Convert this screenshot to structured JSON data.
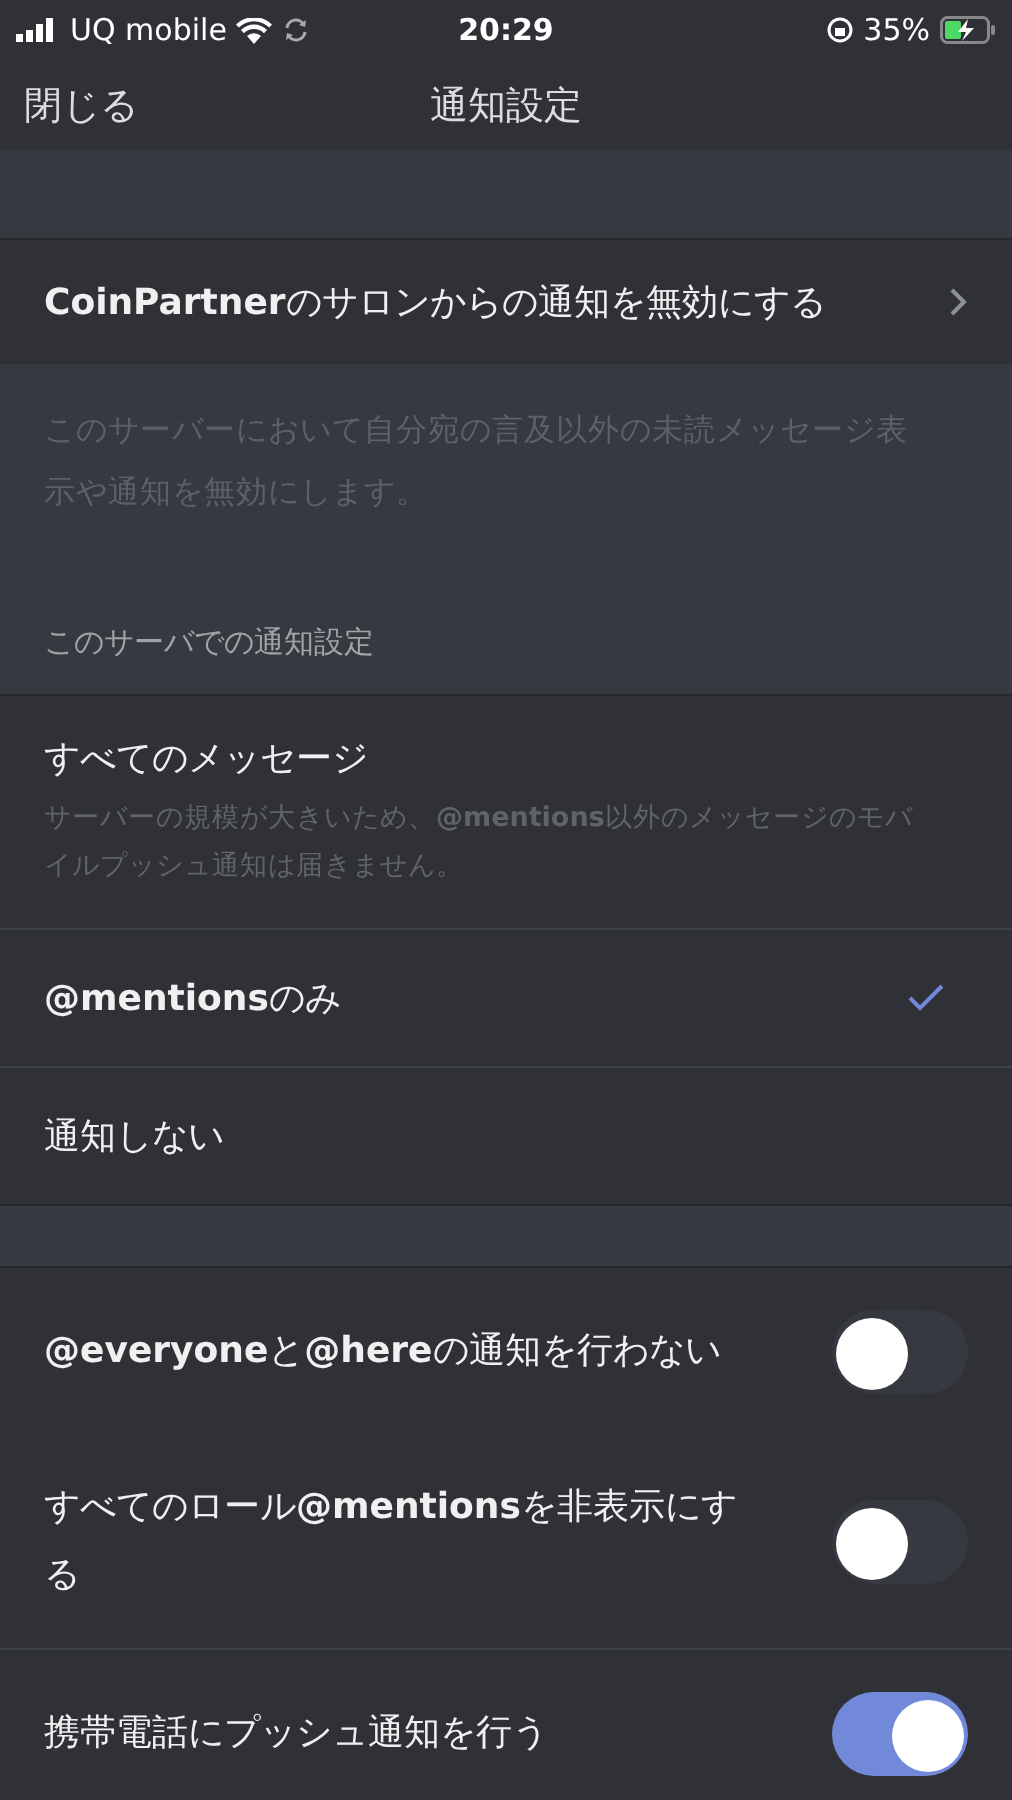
{
  "status_bar": {
    "carrier": "UQ mobile",
    "time": "20:29",
    "battery": "35%"
  },
  "nav": {
    "close": "閉じる",
    "title": "通知設定"
  },
  "mute_row": {
    "label": "**CoinPartner**のサロンからの通知を無効にする",
    "description": "このサーバーにおいて自分宛の言及以外の未読メッセージ表示や通知を無効にします。"
  },
  "section_header": "このサーバでの通知設定",
  "options": [
    {
      "label": "すべてのメッセージ",
      "note": "サーバーの規模が大きいため、**@mentions**以外のメッセージのモバイルプッシュ通知は届きません。",
      "selected": false
    },
    {
      "label": "**@mentions**のみ",
      "selected": true
    },
    {
      "label": "通知しない",
      "selected": false
    }
  ],
  "toggles": [
    {
      "label": "**@everyone**と**@here**の通知を行わない",
      "on": false
    },
    {
      "label": "すべてのロール**@mentions**を非表示にする",
      "on": false
    },
    {
      "label": "携帯電話にプッシュ通知を行う",
      "on": true
    }
  ]
}
